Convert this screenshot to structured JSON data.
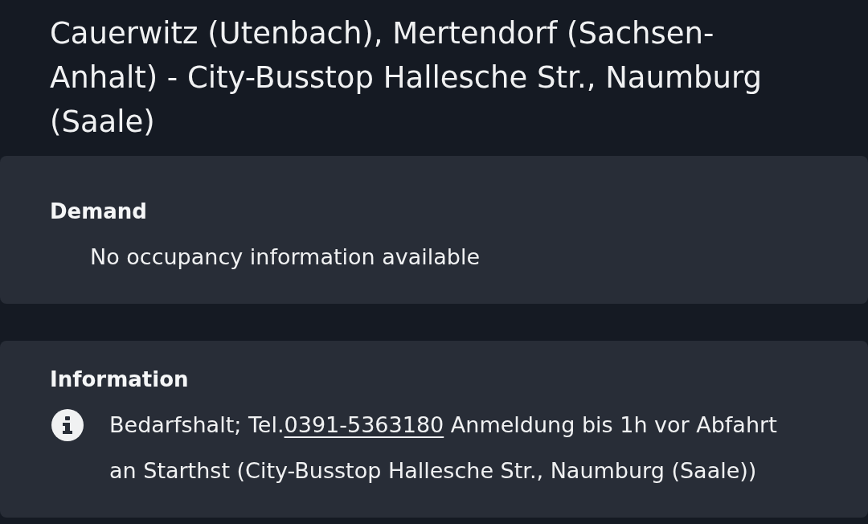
{
  "title": "Cauerwitz (Utenbach), Mertendorf (Sachsen-Anhalt) - City-Busstop Hallesche Str., Naumburg (Saale)",
  "sections": [
    {
      "kind": "demand",
      "heading": "Demand",
      "text": "No occupancy information available"
    },
    {
      "kind": "information",
      "heading": "Information",
      "text_before": "Bedarfshalt; Tel.",
      "link": "0391-5363180",
      "text_after": "Anmeldung bis 1h vor Abfahrt an Starthst (City-Busstop Hallesche Str., Naumburg (Saale))"
    }
  ]
}
